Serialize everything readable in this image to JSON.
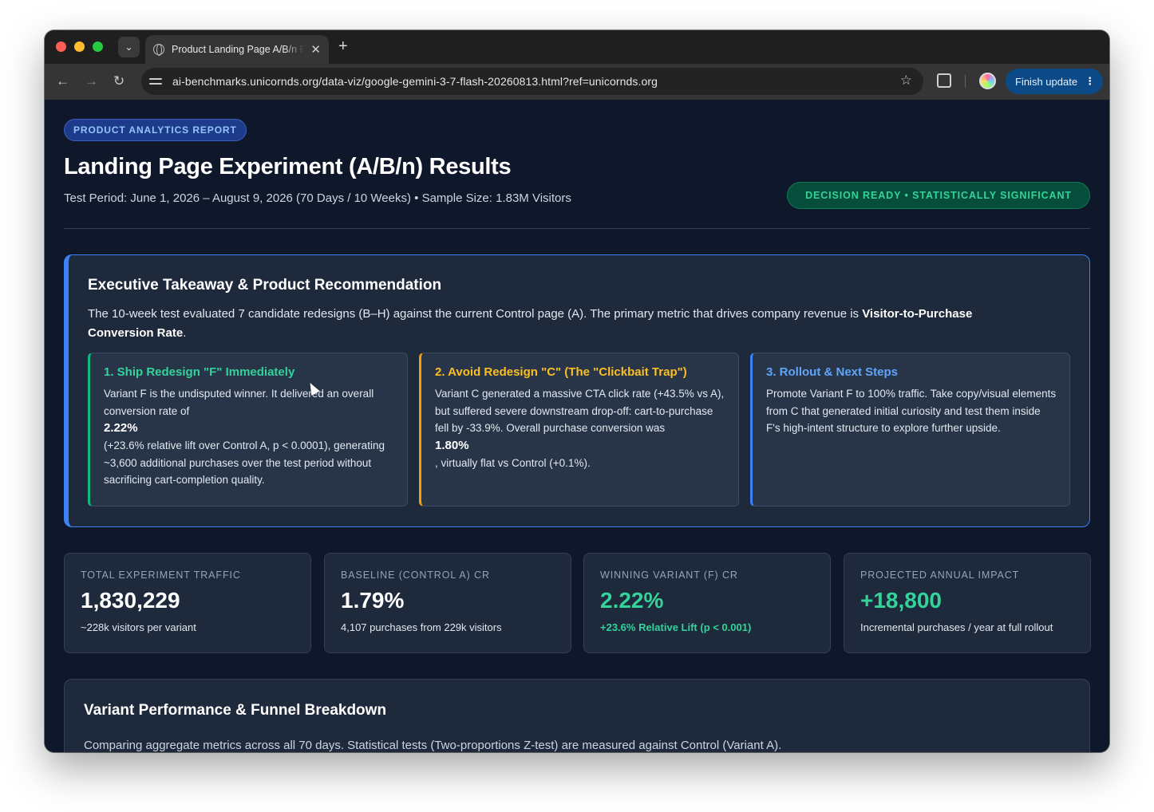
{
  "browser": {
    "tab_title": "Product Landing Page A/B/n Experiment",
    "url": "ai-benchmarks.unicornds.org/data-viz/google-gemini-3-7-flash-20260813.html?ref=unicornds.org",
    "finish_update_label": "Finish update",
    "new_tab_label": "+",
    "close_tab_label": "✕"
  },
  "header": {
    "badge": "PRODUCT ANALYTICS REPORT",
    "title": "Landing Page Experiment (A/B/n) Results",
    "subtitle": "Test Period: June 1, 2026 – August 9, 2026 (70 Days / 10 Weeks) • Sample Size: 1.83M Visitors",
    "status": "DECISION READY • STATISTICALLY SIGNIFICANT"
  },
  "executive": {
    "title": "Executive Takeaway & Product Recommendation",
    "intro_prefix": "The 10-week test evaluated 7 candidate redesigns (B–H) against the current Control page (A). The primary metric that drives company revenue is ",
    "intro_bold": "Visitor-to-Purchase Conversion Rate",
    "intro_suffix": ".",
    "cards": [
      {
        "title": "1. Ship Redesign \"F\" Immediately",
        "text_before": "Variant F is the undisputed winner. It delivered an overall conversion rate of",
        "highlight": "2.22%",
        "text_after": "(+23.6% relative lift over Control A, p < 0.0001), generating ~3,600 additional purchases over the test period without sacrificing cart-completion quality."
      },
      {
        "title": "2. Avoid Redesign \"C\" (The \"Clickbait Trap\")",
        "text_before": "Variant C generated a massive CTA click rate (+43.5% vs A), but suffered severe downstream drop-off: cart-to-purchase fell by -33.9%. Overall purchase conversion was",
        "highlight": "1.80%",
        "text_after": ", virtually flat vs Control (+0.1%)."
      },
      {
        "title": "3. Rollout & Next Steps",
        "text_before": "Promote Variant F to 100% traffic. Take copy/visual elements from C that generated initial curiosity and test them inside F's high-intent structure to explore further upside."
      }
    ]
  },
  "kpis": [
    {
      "label": "TOTAL EXPERIMENT TRAFFIC",
      "value": "1,830,229",
      "note": "~228k visitors per variant"
    },
    {
      "label": "BASELINE (CONTROL A) CR",
      "value": "1.79%",
      "note": "4,107 purchases from 229k visitors"
    },
    {
      "label": "WINNING VARIANT (F) CR",
      "value": "2.22%",
      "note": "+23.6% Relative Lift (p < 0.001)"
    },
    {
      "label": "PROJECTED ANNUAL IMPACT",
      "value": "+18,800",
      "note": "Incremental purchases / year at full rollout"
    }
  ],
  "performance": {
    "title": "Variant Performance & Funnel Breakdown",
    "description": "Comparing aggregate metrics across all 70 days. Statistical tests (Two-proportions Z-test) are measured against Control (Variant A)."
  },
  "colors": {
    "page_bg": "#0f172a",
    "card_bg": "#1e293b",
    "accent_blue": "#3b82f6",
    "success_green": "#34d399",
    "warning_amber": "#fbbf24"
  }
}
